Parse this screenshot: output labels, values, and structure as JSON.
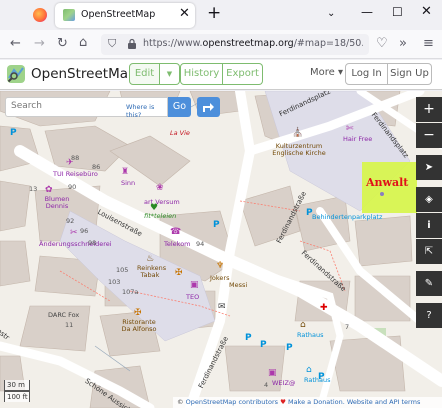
{
  "browser": {
    "tab_title": "OpenStreetMap",
    "tab_close": "✕",
    "new_tab": "+",
    "tab_list": "⌄",
    "window_minimize": "—",
    "window_maximize": "☐",
    "window_close": "✕",
    "url_prefix": "https://www.",
    "url_domain": "openstreetmap.org",
    "url_rest": "/#map=18/50.22463/8",
    "nav_back": "←",
    "nav_forward": "→",
    "nav_reload": "↻",
    "nav_home": "⌂",
    "shield": "⛉",
    "pocket": "♡",
    "extensions": "»",
    "menu": "≡"
  },
  "osm": {
    "title": "OpenStreetMap",
    "edit": "Edit",
    "edit_dropdown": "▼",
    "history": "History",
    "export": "Export",
    "more": "More ▾",
    "login": "Log In",
    "signup": "Sign Up"
  },
  "search": {
    "placeholder": "Search",
    "where_is_this": "Where is this?",
    "go": "Go"
  },
  "map_controls": {
    "zoom_in": "+",
    "zoom_out": "−",
    "locate": "➤",
    "layers": "◈",
    "info": "i",
    "share": "⇱",
    "note": "✎",
    "query": "?"
  },
  "highlight": {
    "label": "Anwalt",
    "color": "#d7f54a",
    "text_color": "#e0101a"
  },
  "labels": {
    "la_vie": "La Vie",
    "tui": "TUI Reisebüro",
    "sinn": "Sinn",
    "art_versum": "art Versum",
    "fitteleien": "fit*teleien",
    "blumen_dennis": "Blumen Dennis",
    "aenderungsschneiderei": "Änderungsschneiderei",
    "telekom": "Telekom",
    "kulturzentrum": "Kulturzentrum Englische Kirche",
    "hair_free": "Hair Free",
    "behindertenparkplatz": "Behindertenparkplatz",
    "reinkens_tabak": "Reinkens Tabak",
    "teo": "TEO",
    "jokers": "Jokers",
    "messi": "Messi",
    "darc": "DARC Fox",
    "ristorante": "Ristorante Da Alfonso",
    "rathaus1": "Rathaus",
    "rathaus2": "Rathaus",
    "weiz": "WEIZ@",
    "hn_88": "88",
    "hn_86": "86",
    "hn_90": "90",
    "hn_92": "92",
    "hn_94": "94",
    "hn_96": "96",
    "hn_98": "98",
    "hn_103": "103",
    "hn_105": "105",
    "hn_107a": "107a",
    "hn_11": "11",
    "hn_7": "7",
    "hn_4": "4",
    "hn_13": "13"
  },
  "streets": {
    "ferdinandsplatz_top": "Ferdinandsplatz",
    "ferdinandsplatz_right": "Ferdinandsplatz",
    "ferdinandstrasse_mid": "Ferdinandstraße",
    "ferdinandstrasse_low": "Ferdinandstraße",
    "ferdinandstrasse_bottom": "Ferdinandstraße",
    "louisenstrasse": "Louisenstraße",
    "schone_aussicht": "Schöne Aussicht"
  },
  "scale": {
    "metric": "30 m",
    "imperial": "100 ft"
  },
  "attribution": {
    "copyright": "© ",
    "contributors": "OpenStreetMap contributors",
    "heart": " ♥ ",
    "donation": "Make a Donation.",
    "sep": " ",
    "website": "Website and API terms"
  }
}
